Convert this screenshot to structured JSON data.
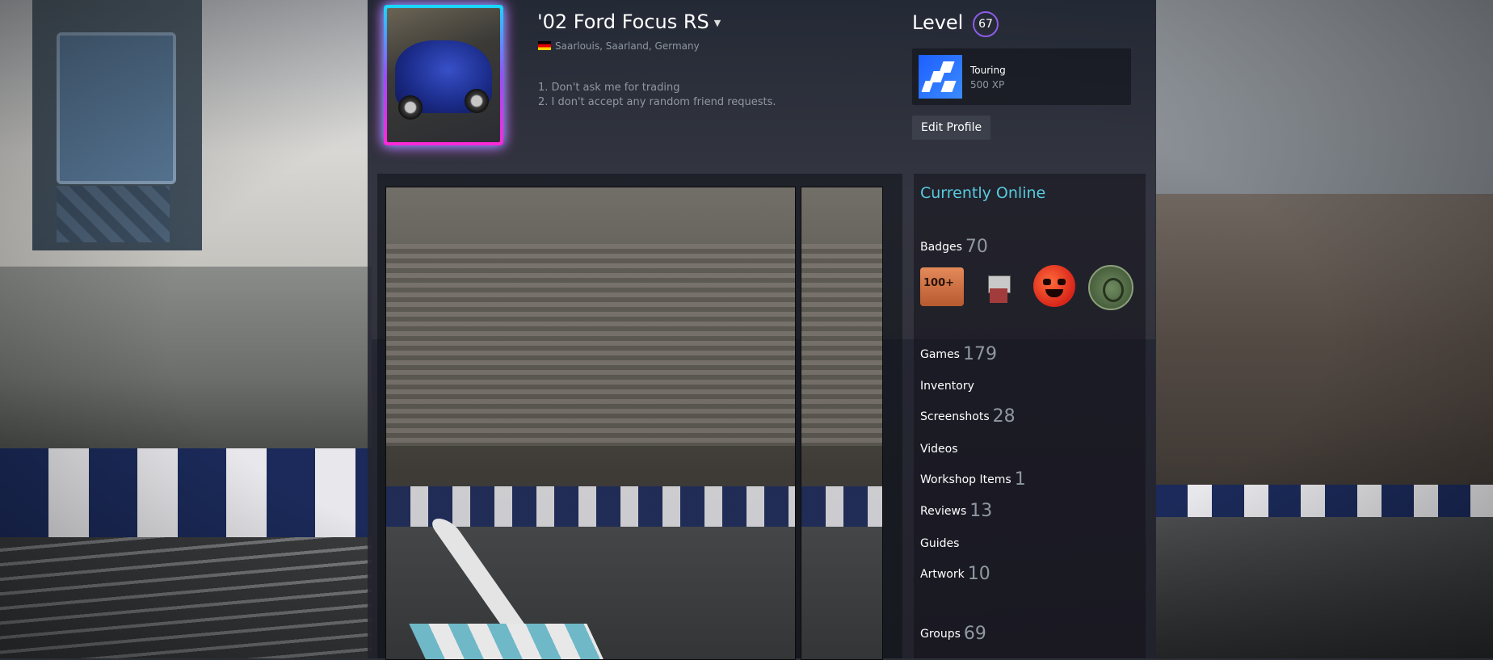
{
  "profile": {
    "persona_name": "'02 Ford Focus RS",
    "dropdown_caret": "▼",
    "location": "Saarlouis, Saarland, Germany",
    "summary_lines": [
      "1. Don't ask me for trading",
      "2. I don't accept any random friend requests."
    ]
  },
  "level": {
    "label": "Level",
    "value": "67"
  },
  "favorite_badge": {
    "name": "Touring",
    "xp": "500 XP"
  },
  "buttons": {
    "edit_profile": "Edit Profile"
  },
  "status": {
    "online": "Currently Online"
  },
  "stats": {
    "badges": {
      "label": "Badges",
      "count": "70"
    },
    "games": {
      "label": "Games",
      "count": "179"
    },
    "inventory": {
      "label": "Inventory"
    },
    "screenshots": {
      "label": "Screenshots",
      "count": "28"
    },
    "videos": {
      "label": "Videos"
    },
    "workshop": {
      "label": "Workshop Items",
      "count": "1"
    },
    "reviews": {
      "label": "Reviews",
      "count": "13"
    },
    "guides": {
      "label": "Guides"
    },
    "artwork": {
      "label": "Artwork",
      "count": "10"
    },
    "groups": {
      "label": "Groups",
      "count": "69"
    }
  },
  "badges_shown": {
    "first_label": "100+"
  },
  "colors": {
    "accent_online": "#57cbde",
    "level_ring": "#8c5ce8",
    "avatar_frame_top": "#18d8ff",
    "avatar_frame_bottom": "#ff28d8"
  }
}
